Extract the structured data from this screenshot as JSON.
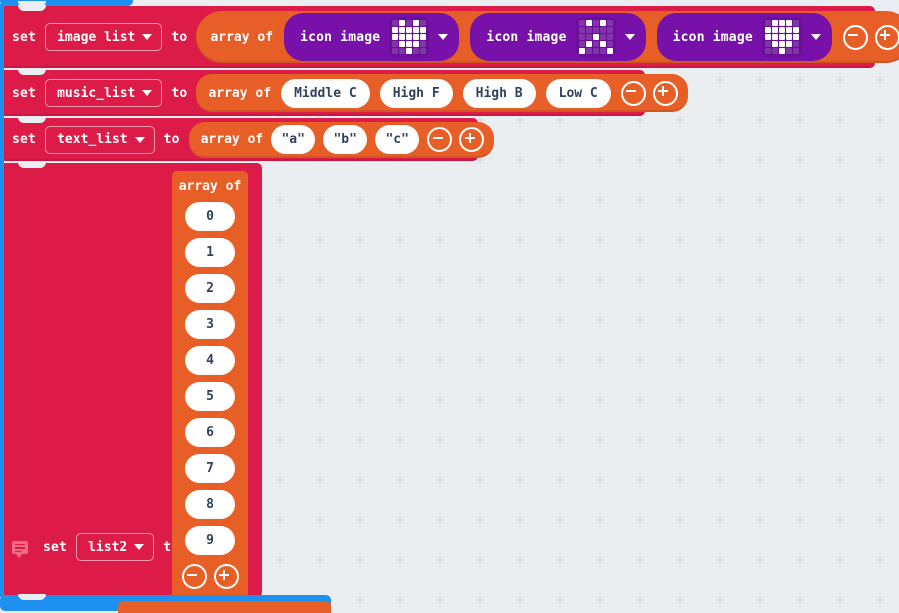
{
  "app": {
    "editor": "microbit-makecode-blocks-workspace",
    "canvas_background": "#ebeef0",
    "colors": {
      "variables_red": "#dd1b48",
      "arrays_orange": "#e75f26",
      "images_purple": "#7711aa",
      "basic_blue": "#1e90f0",
      "chip_white": "#ffffff",
      "chip_text": "#33415c"
    }
  },
  "labels": {
    "set": "set",
    "to": "to",
    "array_of": "array of"
  },
  "blocks": [
    {
      "id": "set-image-list",
      "kind": "variable-set",
      "set_label": "set",
      "variable": "image list",
      "to_label": "to",
      "value": {
        "kind": "array",
        "array_label": "array of",
        "items": [
          {
            "kind": "icon-image",
            "label": "icon image",
            "icon_name": "heart",
            "pattern": "01010,11111,11111,01110,00100"
          },
          {
            "kind": "icon-image",
            "label": "icon image",
            "icon_name": "confused",
            "pattern": "01010,00000,00100,01010,10001"
          },
          {
            "kind": "icon-image",
            "label": "icon image",
            "icon_name": "diamond",
            "pattern": "01110,11111,11111,01110,00100"
          }
        ],
        "remove_button": "remove-item",
        "add_button": "add-item"
      }
    },
    {
      "id": "set-music-list",
      "kind": "variable-set",
      "set_label": "set",
      "variable": "music_list",
      "to_label": "to",
      "value": {
        "kind": "array",
        "array_label": "array of",
        "items": [
          {
            "kind": "note",
            "label": "Middle C"
          },
          {
            "kind": "note",
            "label": "High F"
          },
          {
            "kind": "note",
            "label": "High B"
          },
          {
            "kind": "note",
            "label": "Low C"
          }
        ],
        "remove_button": "remove-item",
        "add_button": "add-item"
      }
    },
    {
      "id": "set-text-list",
      "kind": "variable-set",
      "set_label": "set",
      "variable": "text_list",
      "to_label": "to",
      "value": {
        "kind": "array",
        "array_label": "array of",
        "items": [
          {
            "kind": "text",
            "label": "\"a\""
          },
          {
            "kind": "text",
            "label": "\"b\""
          },
          {
            "kind": "text",
            "label": "\"c\""
          }
        ],
        "remove_button": "remove-item",
        "add_button": "add-item"
      }
    },
    {
      "id": "set-list2",
      "kind": "variable-set",
      "has_comment_icon": true,
      "comment_icon": "comment-icon",
      "set_label": "set",
      "variable": "list2",
      "to_label": "to",
      "value": {
        "kind": "array-vertical",
        "array_label": "array of",
        "items": [
          {
            "kind": "number",
            "label": "0"
          },
          {
            "kind": "number",
            "label": "1"
          },
          {
            "kind": "number",
            "label": "2"
          },
          {
            "kind": "number",
            "label": "3"
          },
          {
            "kind": "number",
            "label": "4"
          },
          {
            "kind": "number",
            "label": "5"
          },
          {
            "kind": "number",
            "label": "6"
          },
          {
            "kind": "number",
            "label": "7"
          },
          {
            "kind": "number",
            "label": "8"
          },
          {
            "kind": "number",
            "label": "9"
          }
        ],
        "remove_button": "remove-item",
        "add_button": "add-item"
      }
    }
  ]
}
